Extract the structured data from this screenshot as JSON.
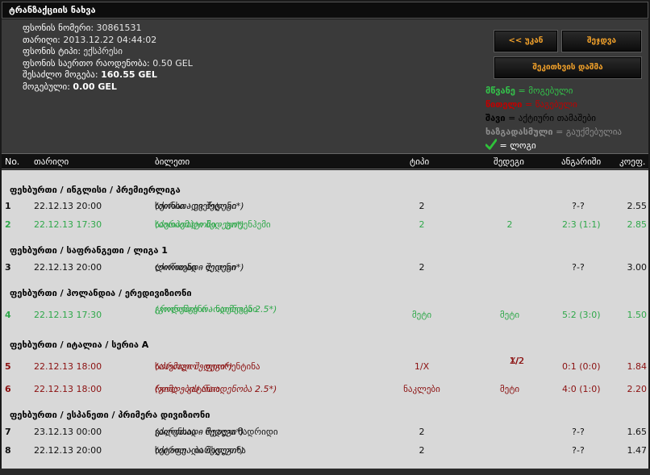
{
  "title": "ტრანზაქციის ნახვა",
  "info": {
    "slip_number_label": "ფსონის ნომერი:",
    "slip_number": "30861531",
    "date_label": "თარიღი:",
    "date": "2013.12.22 04:44:02",
    "type_label": "ფსონის ტიპი:",
    "type": "ექსპრესი",
    "total_stake_label": "ფსონის საერთო რაოდენობა:",
    "total_stake": "0.50 GEL",
    "possible_win_label": "შესაძლო მოგება:",
    "possible_win": "160.55 GEL",
    "won_label": "მოგებული:",
    "won": "0.00 GEL"
  },
  "buttons": {
    "back": "<< უკან",
    "cashout": "შეჯდვა",
    "reserve_bet": "შეკითხვის დაშმა"
  },
  "legend": {
    "green_key": "მწვანე",
    "green_val": "მოგებული",
    "red_key": "წითელი",
    "red_val": "წაგებული",
    "black_key": "შავი",
    "black_val": "აქტიური თამაშები",
    "gray_key": "ხაზგადასმული",
    "gray_val": "გაუქმებულია",
    "check_val": "ლოგი",
    "eq": "=",
    "colors": {
      "green": "#33c24a",
      "red": "#c00000",
      "black": "#000000",
      "gray": "#8c8c8c"
    },
    "check_icon": "check-icon"
  },
  "columns": {
    "no": "No.",
    "date": "თარიღი",
    "ticket": "ბილეთი",
    "type": "ტიპი",
    "result": "შედეგი",
    "calc": "ანგარიში",
    "coef": "კოეფ."
  },
  "sections": [
    {
      "title": "ფეხბურთი / ინგლისი / პრემიერლიგა"
    },
    {
      "title": "ფეხბურთი / საფრანგეთი / ლიგა 1"
    },
    {
      "title": "ფეხბურთი / ჰოლანდია / ერედივიზიონი"
    },
    {
      "title": "ფეხბურთი / იტალია / სერია A"
    },
    {
      "title": "ფეხბურთი / ესპანეთი / პრიმერა დივიზიონი"
    }
  ],
  "rows": [
    {
      "no": "1",
      "date": "22.12.13 20:00",
      "match": "სუონსი - ევერტონი",
      "market": "(ძირითადი შედეგი*)",
      "type": "2",
      "result": "",
      "calc": "?-?",
      "coef": "2.55",
      "status": "active"
    },
    {
      "no": "2",
      "date": "22.12.13 17:30",
      "match": "საუთჰემპტონი - ტოტენჰემი",
      "market": "(ძირითადი შედეგი*)",
      "type": "2",
      "result": "2",
      "calc": "2:3 (1:1)",
      "coef": "2.85",
      "status": "won"
    },
    {
      "no": "3",
      "date": "22.12.13 20:00",
      "match": "ლორიენი - ლიონი",
      "market": "(ძირითადი შედეგი*)",
      "type": "2",
      "result": "",
      "calc": "?-?",
      "coef": "3.00",
      "status": "active"
    },
    {
      "no": "4",
      "date": "22.12.13 17:30",
      "match": "გრონინგენი - ნაიმეგენი",
      "market": "(გოლების რაოდენობა 2.5*)",
      "type": "მეტი",
      "result": "მეტი",
      "calc": "5:2 (3:0)",
      "coef": "1.50",
      "status": "won"
    },
    {
      "no": "5",
      "date": "22.12.13 18:00",
      "match": "სასუოლო - ფიორენტინა",
      "market": "(ორმაგი შედეგი*)",
      "type": "1/X",
      "result": "1/2",
      "result2": "X/2",
      "calc": "0:1 (0:0)",
      "coef": "1.84",
      "status": "lost"
    },
    {
      "no": "6",
      "date": "22.12.13 18:00",
      "match": "რომა - კატანია",
      "market": "(გოლების რაოდენობა 2.5*)",
      "type": "ნაკლები",
      "result": "მეტი",
      "calc": "4:0 (1:0)",
      "coef": "2.20",
      "status": "lost"
    },
    {
      "no": "7",
      "date": "23.12.13 00:00",
      "match": "ვალენსია - რეალი მადრიდი",
      "market": "(ძირითადი შედეგი*)",
      "type": "2",
      "result": "",
      "calc": "?-?",
      "coef": "1.65",
      "status": "active"
    },
    {
      "no": "8",
      "date": "22.12.13 20:00",
      "match": "ხეტაფე - ბარსელონა",
      "market": "(ძირითადი შედეგი*)",
      "type": "2",
      "result": "",
      "calc": "?-?",
      "coef": "1.47",
      "status": "active"
    }
  ]
}
